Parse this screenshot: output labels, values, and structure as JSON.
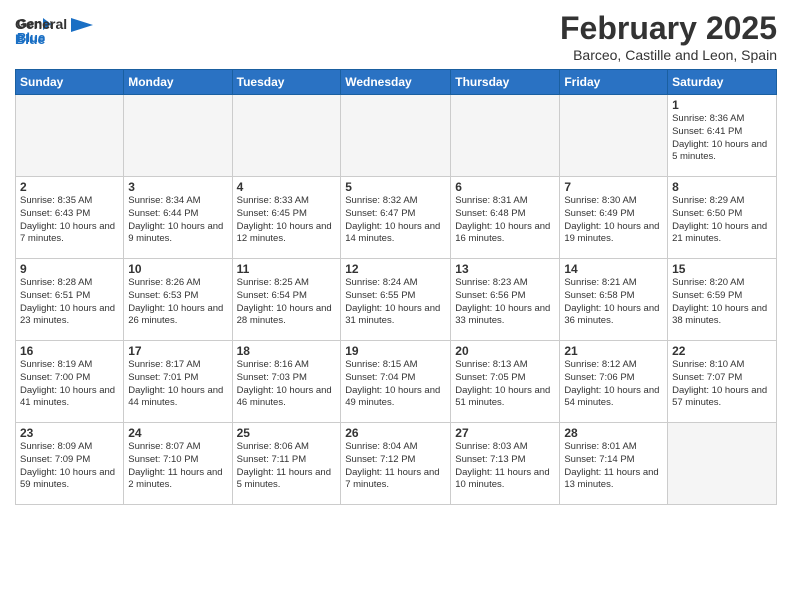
{
  "header": {
    "logo_line1": "General",
    "logo_line2": "Blue",
    "month": "February 2025",
    "location": "Barceo, Castille and Leon, Spain"
  },
  "weekdays": [
    "Sunday",
    "Monday",
    "Tuesday",
    "Wednesday",
    "Thursday",
    "Friday",
    "Saturday"
  ],
  "weeks": [
    [
      {
        "day": "",
        "info": ""
      },
      {
        "day": "",
        "info": ""
      },
      {
        "day": "",
        "info": ""
      },
      {
        "day": "",
        "info": ""
      },
      {
        "day": "",
        "info": ""
      },
      {
        "day": "",
        "info": ""
      },
      {
        "day": "1",
        "info": "Sunrise: 8:36 AM\nSunset: 6:41 PM\nDaylight: 10 hours\nand 5 minutes."
      }
    ],
    [
      {
        "day": "2",
        "info": "Sunrise: 8:35 AM\nSunset: 6:43 PM\nDaylight: 10 hours\nand 7 minutes."
      },
      {
        "day": "3",
        "info": "Sunrise: 8:34 AM\nSunset: 6:44 PM\nDaylight: 10 hours\nand 9 minutes."
      },
      {
        "day": "4",
        "info": "Sunrise: 8:33 AM\nSunset: 6:45 PM\nDaylight: 10 hours\nand 12 minutes."
      },
      {
        "day": "5",
        "info": "Sunrise: 8:32 AM\nSunset: 6:47 PM\nDaylight: 10 hours\nand 14 minutes."
      },
      {
        "day": "6",
        "info": "Sunrise: 8:31 AM\nSunset: 6:48 PM\nDaylight: 10 hours\nand 16 minutes."
      },
      {
        "day": "7",
        "info": "Sunrise: 8:30 AM\nSunset: 6:49 PM\nDaylight: 10 hours\nand 19 minutes."
      },
      {
        "day": "8",
        "info": "Sunrise: 8:29 AM\nSunset: 6:50 PM\nDaylight: 10 hours\nand 21 minutes."
      }
    ],
    [
      {
        "day": "9",
        "info": "Sunrise: 8:28 AM\nSunset: 6:51 PM\nDaylight: 10 hours\nand 23 minutes."
      },
      {
        "day": "10",
        "info": "Sunrise: 8:26 AM\nSunset: 6:53 PM\nDaylight: 10 hours\nand 26 minutes."
      },
      {
        "day": "11",
        "info": "Sunrise: 8:25 AM\nSunset: 6:54 PM\nDaylight: 10 hours\nand 28 minutes."
      },
      {
        "day": "12",
        "info": "Sunrise: 8:24 AM\nSunset: 6:55 PM\nDaylight: 10 hours\nand 31 minutes."
      },
      {
        "day": "13",
        "info": "Sunrise: 8:23 AM\nSunset: 6:56 PM\nDaylight: 10 hours\nand 33 minutes."
      },
      {
        "day": "14",
        "info": "Sunrise: 8:21 AM\nSunset: 6:58 PM\nDaylight: 10 hours\nand 36 minutes."
      },
      {
        "day": "15",
        "info": "Sunrise: 8:20 AM\nSunset: 6:59 PM\nDaylight: 10 hours\nand 38 minutes."
      }
    ],
    [
      {
        "day": "16",
        "info": "Sunrise: 8:19 AM\nSunset: 7:00 PM\nDaylight: 10 hours\nand 41 minutes."
      },
      {
        "day": "17",
        "info": "Sunrise: 8:17 AM\nSunset: 7:01 PM\nDaylight: 10 hours\nand 44 minutes."
      },
      {
        "day": "18",
        "info": "Sunrise: 8:16 AM\nSunset: 7:03 PM\nDaylight: 10 hours\nand 46 minutes."
      },
      {
        "day": "19",
        "info": "Sunrise: 8:15 AM\nSunset: 7:04 PM\nDaylight: 10 hours\nand 49 minutes."
      },
      {
        "day": "20",
        "info": "Sunrise: 8:13 AM\nSunset: 7:05 PM\nDaylight: 10 hours\nand 51 minutes."
      },
      {
        "day": "21",
        "info": "Sunrise: 8:12 AM\nSunset: 7:06 PM\nDaylight: 10 hours\nand 54 minutes."
      },
      {
        "day": "22",
        "info": "Sunrise: 8:10 AM\nSunset: 7:07 PM\nDaylight: 10 hours\nand 57 minutes."
      }
    ],
    [
      {
        "day": "23",
        "info": "Sunrise: 8:09 AM\nSunset: 7:09 PM\nDaylight: 10 hours\nand 59 minutes."
      },
      {
        "day": "24",
        "info": "Sunrise: 8:07 AM\nSunset: 7:10 PM\nDaylight: 11 hours\nand 2 minutes."
      },
      {
        "day": "25",
        "info": "Sunrise: 8:06 AM\nSunset: 7:11 PM\nDaylight: 11 hours\nand 5 minutes."
      },
      {
        "day": "26",
        "info": "Sunrise: 8:04 AM\nSunset: 7:12 PM\nDaylight: 11 hours\nand 7 minutes."
      },
      {
        "day": "27",
        "info": "Sunrise: 8:03 AM\nSunset: 7:13 PM\nDaylight: 11 hours\nand 10 minutes."
      },
      {
        "day": "28",
        "info": "Sunrise: 8:01 AM\nSunset: 7:14 PM\nDaylight: 11 hours\nand 13 minutes."
      },
      {
        "day": "",
        "info": ""
      }
    ]
  ]
}
